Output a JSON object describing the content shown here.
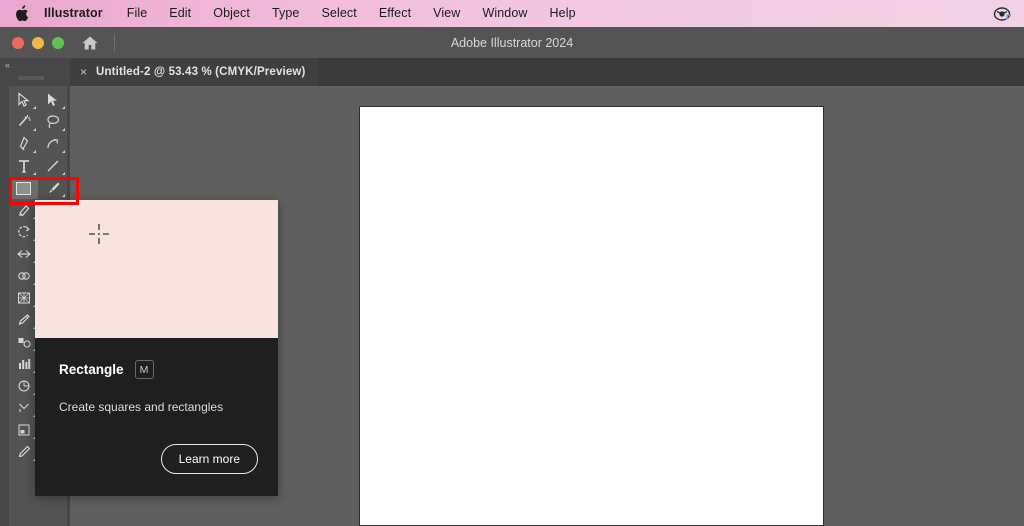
{
  "menubar": {
    "apple_icon": "apple-logo-icon",
    "items": [
      {
        "label": "Illustrator",
        "bold": true
      },
      {
        "label": "File",
        "bold": false
      },
      {
        "label": "Edit",
        "bold": false
      },
      {
        "label": "Object",
        "bold": false
      },
      {
        "label": "Type",
        "bold": false
      },
      {
        "label": "Select",
        "bold": false
      },
      {
        "label": "Effect",
        "bold": false
      },
      {
        "label": "View",
        "bold": false
      },
      {
        "label": "Window",
        "bold": false
      },
      {
        "label": "Help",
        "bold": false
      }
    ],
    "status_icon": "screen-sharing-icon",
    "gradient_start": "#e9a6cf",
    "gradient_end": "#f1d3e4"
  },
  "titlebar": {
    "app_title": "Adobe Illustrator 2024",
    "home_icon": "home-icon",
    "lights": [
      {
        "name": "close-button",
        "color": "#ec6a5e"
      },
      {
        "name": "minimize-button",
        "color": "#f2b949"
      },
      {
        "name": "maximize-button",
        "color": "#5fc354"
      }
    ]
  },
  "tabbar": {
    "close_glyph": "×",
    "active_tab_label": "Untitled-2 @ 53.43 % (CMYK/Preview)"
  },
  "leftpanel": {
    "collapse_glyph": "«"
  },
  "toolbar": {
    "tools": [
      [
        "selection-tool",
        "direct-selection-tool"
      ],
      [
        "magic-wand-tool",
        "lasso-tool"
      ],
      [
        "pen-tool",
        "curvature-tool"
      ],
      [
        "type-tool",
        "line-segment-tool"
      ],
      [
        "rectangle-tool",
        "paintbrush-tool"
      ],
      [
        "shaper-tool",
        "pencil-tool-2"
      ],
      [
        "rotate-tool",
        "scale-tool"
      ],
      [
        "width-tool",
        "free-transform-tool"
      ],
      [
        "shape-builder-tool",
        "puppet-warp-tool"
      ],
      [
        "perspective-grid-tool",
        "mesh-tool"
      ],
      [
        "gradient-tool",
        "eyedropper-tool"
      ],
      [
        "blend-tool",
        "symbol-sprayer-tool"
      ],
      [
        "column-graph-tool",
        "artboard-tool"
      ],
      [
        "slice-tool",
        "measure-tool"
      ],
      [
        "pie-graph-tool",
        "zoom-tool-2"
      ],
      [
        "anchor-point-tool",
        "scissors-tool"
      ],
      [
        "join-tool",
        "smooth-tool"
      ],
      [
        "artboard-panel-tool",
        "page-tool"
      ],
      [
        "pencil-tool",
        "hand-tool"
      ]
    ],
    "active_tool": "rectangle-tool",
    "highlight_color": "#ff0000"
  },
  "canvas": {
    "background": "#5f5f5f",
    "artboard_fill": "#ffffff"
  },
  "coachmark": {
    "media_bg": "#f7e4de",
    "cursor_icon": "crosshair-cursor-icon",
    "title": "Rectangle",
    "shortcut_key": "M",
    "description": "Create squares and rectangles",
    "cta_label": "Learn more"
  }
}
